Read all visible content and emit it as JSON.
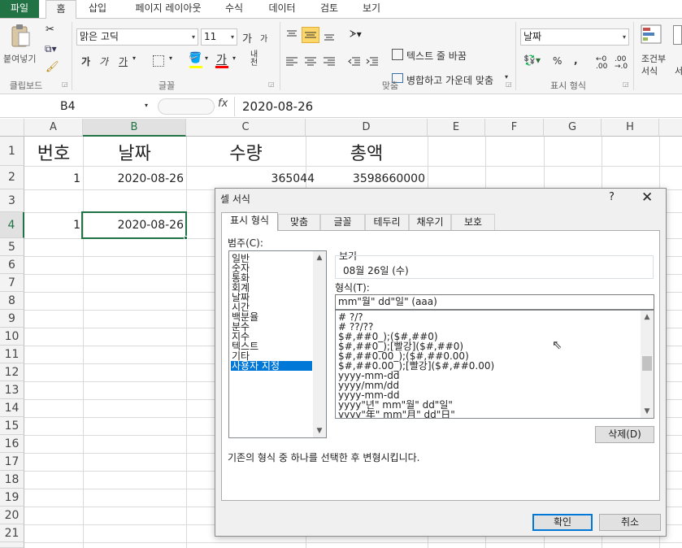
{
  "ribbon": {
    "tabs": [
      {
        "label": "파일",
        "left": 0
      },
      {
        "label": "홈",
        "active": true
      },
      {
        "label": "삽입"
      },
      {
        "label": "페이지 레이아웃"
      },
      {
        "label": "수식"
      },
      {
        "label": "데이터"
      },
      {
        "label": "검토"
      },
      {
        "label": "보기"
      }
    ],
    "clipboard": {
      "paste": "붙여넣기",
      "label": "클립보드"
    },
    "font": {
      "name": "맑은 고딕",
      "size": "11",
      "grow": "가",
      "shrink": "가",
      "bold": "가",
      "italic": "가",
      "underline": "가",
      "label": "글꼴"
    },
    "align": {
      "wrap": "텍스트 줄 바꿈",
      "merge": "병합하고 가운데 맞춤",
      "label": "맞춤"
    },
    "number": {
      "format": "날짜",
      "percent": "%",
      "comma": ",",
      "label": "표시 형식"
    },
    "styles": {
      "conditional_line1": "조건부",
      "conditional_line2": "서식",
      "table_char": "서"
    }
  },
  "formula_bar": {
    "cell_ref": "B4",
    "fx": "fx",
    "value": "2020-08-26"
  },
  "grid": {
    "columns": [
      "A",
      "B",
      "C",
      "D",
      "E",
      "F",
      "G",
      "H"
    ],
    "selected_column": "B",
    "rows": [
      "1",
      "2",
      "3",
      "4",
      "5",
      "6",
      "7",
      "8",
      "9",
      "10",
      "11",
      "12",
      "13",
      "14",
      "15",
      "16",
      "17",
      "18",
      "19",
      "20",
      "21"
    ],
    "selected_row": "4",
    "headers": {
      "a1": "번호",
      "b1": "날짜",
      "c1": "수량",
      "d1": "총액"
    },
    "row2": {
      "a": "1",
      "b": "2020-08-26",
      "c": "365044",
      "d": "3598660000"
    },
    "row4": {
      "a": "1",
      "b": "2020-08-26"
    }
  },
  "dialog": {
    "title": "셀 서식",
    "help": "?",
    "close": "✕",
    "tabs": [
      "표시 형식",
      "맞춤",
      "글꼴",
      "테두리",
      "채우기",
      "보호"
    ],
    "category_label": "범주(C):",
    "categories": [
      "일반",
      "숫자",
      "통화",
      "회계",
      "날짜",
      "시간",
      "백분율",
      "분수",
      "지수",
      "텍스트",
      "기타",
      "사용자 지정"
    ],
    "selected_category": "사용자 지정",
    "sample_label": "보기",
    "sample_value": "08월 26일 (수)",
    "type_label": "형식(T):",
    "type_value": "mm\"월\" dd\"일\" (aaa)",
    "formats": [
      "# ?/?",
      "# ??/??",
      "$#,##0_);($#,##0)",
      "$#,##0_);[빨강]($#,##0)",
      "$#,##0.00_);($#,##0.00)",
      "$#,##0.00_);[빨강]($#,##0.00)",
      "yyyy-mm-dd",
      "yyyy/mm/dd",
      "yyyy-mm-dd",
      "yyyy\"년\" mm\"월\" dd\"일\"",
      "yyyy\"年\" mm\"月\" dd\"日\""
    ],
    "delete_button": "삭제(D)",
    "description": "기존의 형식 중 하나를 선택한 후 변형시킵니다.",
    "ok_button": "확인",
    "cancel_button": "취소"
  },
  "colors": {
    "excel_green": "#217346",
    "selection_blue": "#0078d7"
  }
}
